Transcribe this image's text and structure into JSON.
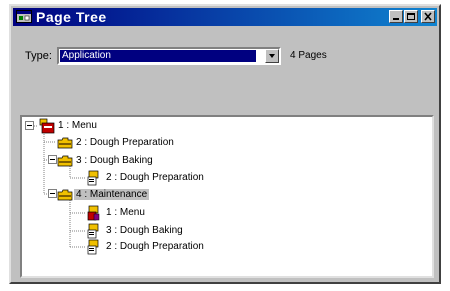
{
  "window": {
    "title": "Page Tree"
  },
  "toolbar": {
    "type_label": "Type:",
    "type_value": "Application",
    "pages_count": "4 Pages"
  },
  "tree": {
    "nodes": [
      {
        "label": "1 : Menu"
      },
      {
        "label": "2 : Dough Preparation"
      },
      {
        "label": "3 : Dough Baking"
      },
      {
        "label": "2 : Dough Preparation"
      },
      {
        "label": "4 : Maintenance"
      },
      {
        "label": "1 : Menu"
      },
      {
        "label": "3 : Dough Baking"
      },
      {
        "label": "2 : Dough Preparation"
      }
    ]
  },
  "colors": {
    "titlebar_start": "#000080",
    "titlebar_end": "#1084d0",
    "window_face": "#c0c0c0",
    "folder_yellow": "#f0c000",
    "page_red": "#c00000"
  },
  "icons": {
    "window": "app-window-icon",
    "folder": "folder-icon",
    "page": "page-icon",
    "menu_page": "menu-page-icon"
  }
}
